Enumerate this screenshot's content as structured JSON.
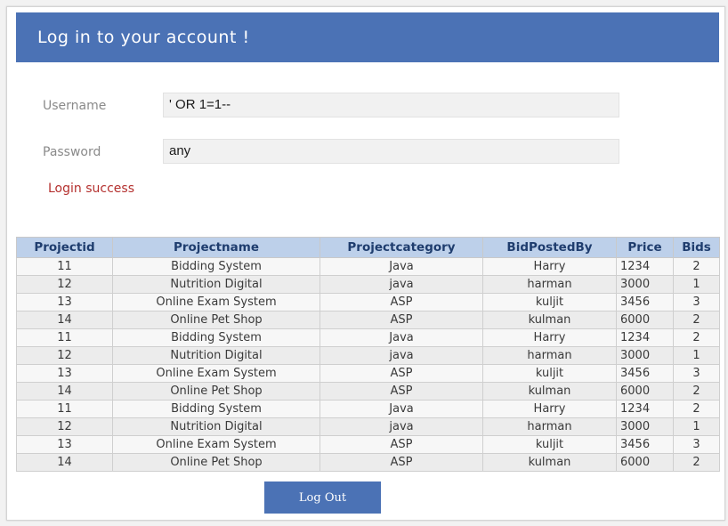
{
  "header": {
    "title": "Log in to your account !"
  },
  "form": {
    "username_label": "Username",
    "username_value": "' OR 1=1--",
    "password_label": "Password",
    "password_value": "any",
    "status": "Login success"
  },
  "table": {
    "columns": [
      "Projectid",
      "Projectname",
      "Projectcategory",
      "BidPostedBy",
      "Price",
      "Bids"
    ],
    "rows": [
      [
        "11",
        "Bidding System",
        "Java",
        "Harry",
        "1234",
        "2"
      ],
      [
        "12",
        "Nutrition Digital",
        "java",
        "harman",
        "3000",
        "1"
      ],
      [
        "13",
        "Online Exam System",
        "ASP",
        "kuljit",
        "3456",
        "3"
      ],
      [
        "14",
        "Online Pet Shop",
        "ASP",
        "kulman",
        "6000",
        "2"
      ],
      [
        "11",
        "Bidding System",
        "Java",
        "Harry",
        "1234",
        "2"
      ],
      [
        "12",
        "Nutrition Digital",
        "java",
        "harman",
        "3000",
        "1"
      ],
      [
        "13",
        "Online Exam System",
        "ASP",
        "kuljit",
        "3456",
        "3"
      ],
      [
        "14",
        "Online Pet Shop",
        "ASP",
        "kulman",
        "6000",
        "2"
      ],
      [
        "11",
        "Bidding System",
        "Java",
        "Harry",
        "1234",
        "2"
      ],
      [
        "12",
        "Nutrition Digital",
        "java",
        "harman",
        "3000",
        "1"
      ],
      [
        "13",
        "Online Exam System",
        "ASP",
        "kuljit",
        "3456",
        "3"
      ],
      [
        "14",
        "Online Pet Shop",
        "ASP",
        "kulman",
        "6000",
        "2"
      ]
    ]
  },
  "actions": {
    "logout_label": "Log Out"
  },
  "colors": {
    "accent": "#4b72b5",
    "header_row": "#bdd0ea",
    "status": "#b4302e"
  }
}
